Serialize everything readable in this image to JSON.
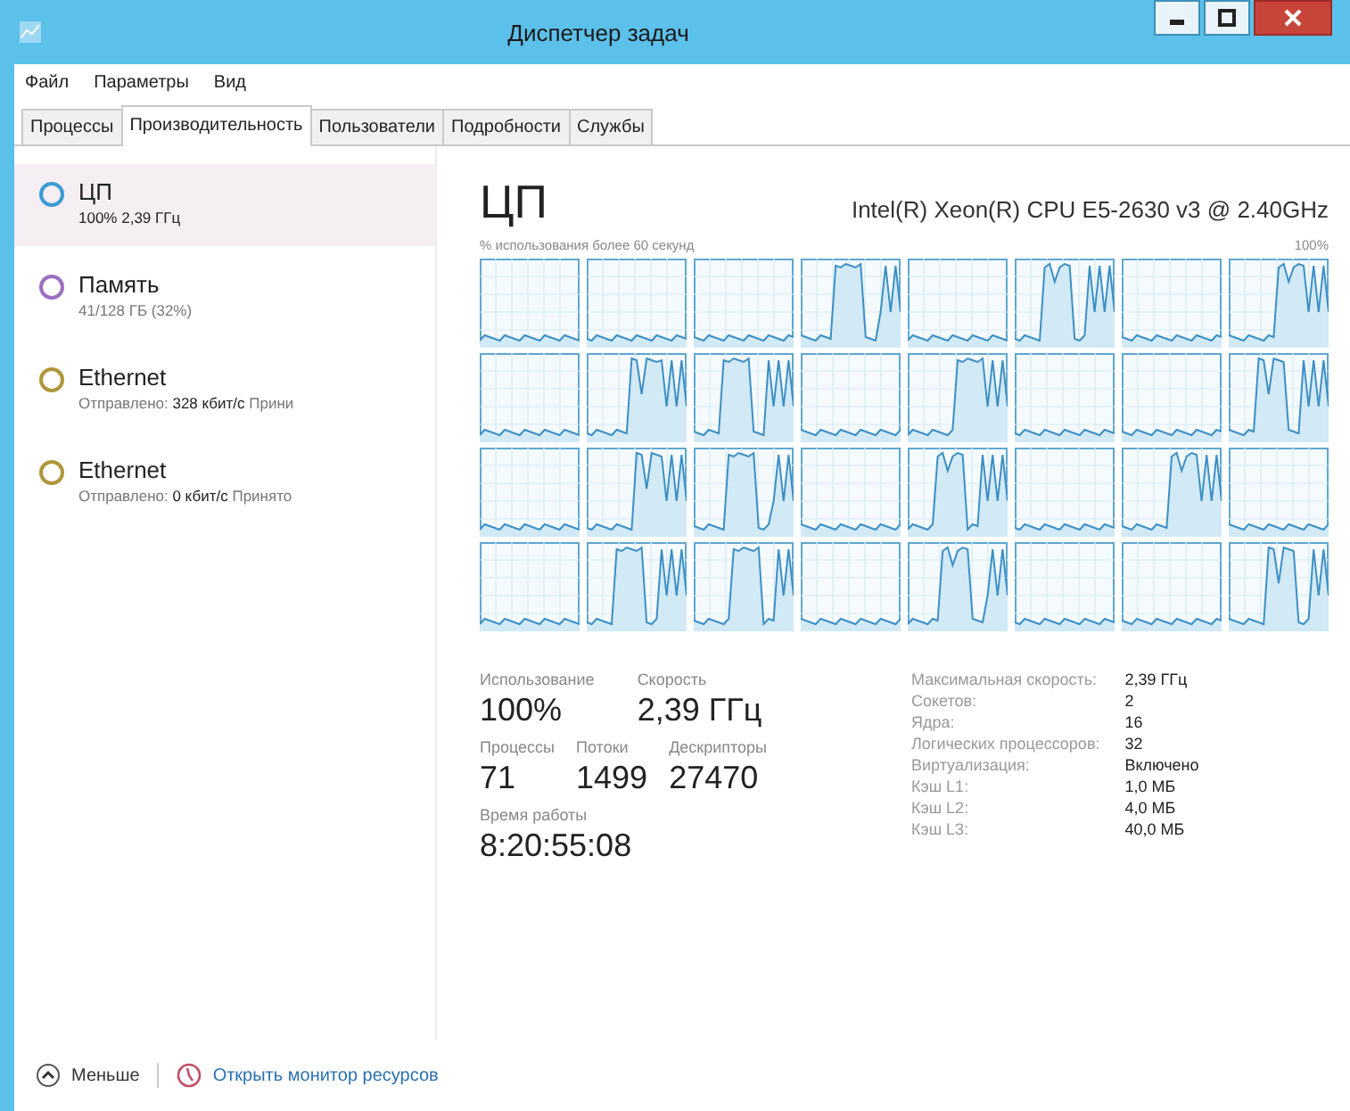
{
  "window": {
    "title": "Диспетчер задач"
  },
  "menu": [
    "Файл",
    "Параметры",
    "Вид"
  ],
  "tabs": [
    {
      "label": "Процессы",
      "selected": false
    },
    {
      "label": "Производительность",
      "selected": true
    },
    {
      "label": "Пользователи",
      "selected": false
    },
    {
      "label": "Подробности",
      "selected": false
    },
    {
      "label": "Службы",
      "selected": false
    }
  ],
  "sidebar": {
    "items": [
      {
        "name": "ЦП",
        "detail": "100% 2,39 ГГц",
        "color": "#3c9bd4",
        "selected": true
      },
      {
        "name": "Память",
        "detail": "41/128 ГБ (32%)",
        "color": "#9b6fc2",
        "selected": false
      },
      {
        "name": "Ethernet",
        "detail": "Отправлено: **328 кбит/с** Прини",
        "color": "#b0963c",
        "selected": false
      },
      {
        "name": "Ethernet",
        "detail": "Отправлено: **0 кбит/с** Принято",
        "color": "#b0963c",
        "selected": false
      }
    ]
  },
  "panel": {
    "title": "ЦП",
    "model": "Intel(R) Xeon(R) CPU E5-2630 v3 @ 2.40GHz",
    "graph_label": "% использования более 60 секунд",
    "graph_max": "100%",
    "stats": [
      {
        "label": "Использование",
        "value": "100%"
      },
      {
        "label": "Скорость",
        "value": "2,39 ГГц"
      }
    ],
    "stats2": [
      {
        "label": "Процессы",
        "value": "71"
      },
      {
        "label": "Потоки",
        "value": "1499"
      },
      {
        "label": "Дескрипторы",
        "value": "27470"
      }
    ],
    "uptime": {
      "label": "Время работы",
      "value": "8:20:55:08"
    },
    "specs": [
      {
        "key": "Максимальная скорость:",
        "value": "2,39 ГГц"
      },
      {
        "key": "Сокетов:",
        "value": "2"
      },
      {
        "key": "Ядра:",
        "value": "16"
      },
      {
        "key": "Логических процессоров:",
        "value": "32"
      },
      {
        "key": "Виртуализация:",
        "value": "Включено"
      },
      {
        "key": "Кэш L1:",
        "value": "1,0 МБ"
      },
      {
        "key": "Кэш L2:",
        "value": "4,0 МБ"
      },
      {
        "key": "Кэш L3:",
        "value": "40,0 МБ"
      }
    ]
  },
  "footer": {
    "less": "Меньше",
    "monitor": "Открыть монитор ресурсов"
  }
}
